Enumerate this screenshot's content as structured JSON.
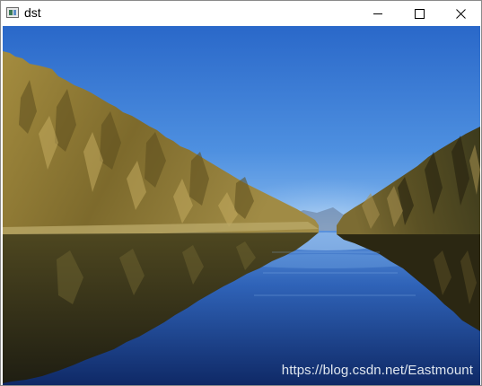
{
  "window": {
    "title": "dst",
    "controls": {
      "minimize_icon": "minimize-icon",
      "maximize_icon": "maximize-icon",
      "close_icon": "close-icon"
    }
  },
  "image": {
    "watermark": "https://blog.csdn.net/Eastmount",
    "colors": {
      "sky_top": "#2c6fcf",
      "sky_mid": "#5a9be6",
      "horizon_glow": "#9cc7f0",
      "forest_light": "#b09a4c",
      "forest_mid": "#7f6a2c",
      "forest_dark": "#3d3718",
      "water_top": "#4b82d2",
      "water_bottom": "#102a6c"
    }
  }
}
